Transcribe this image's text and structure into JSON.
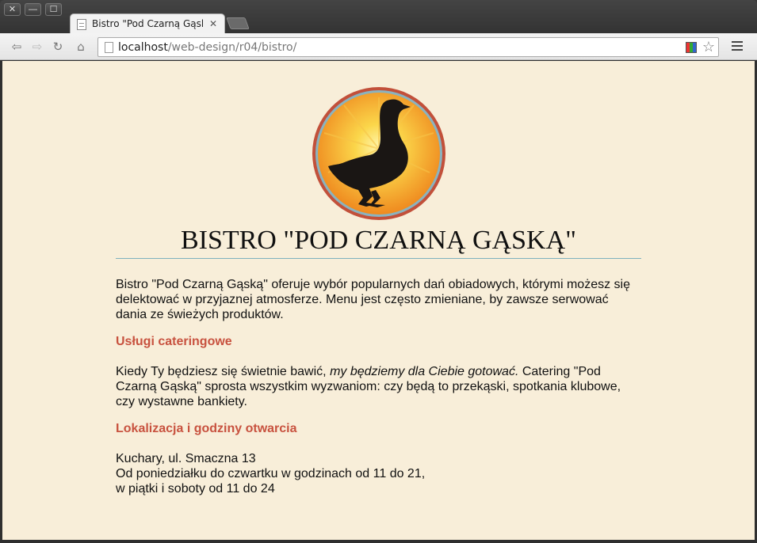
{
  "window": {
    "controls": {
      "close": "✕",
      "minimize": "—",
      "maximize": "☐"
    }
  },
  "tab": {
    "title": "Bistro \"Pod Czarną Gąską\"",
    "close_glyph": "✕"
  },
  "toolbar": {
    "url_host": "localhost",
    "url_path": "/web-design/r04/bistro/",
    "icons": [
      "back-icon",
      "forward-icon",
      "reload-icon",
      "home-icon",
      "page-icon",
      "extension-icon",
      "star-icon",
      "menu-icon"
    ]
  },
  "page": {
    "title": "BISTRO \"POD CZARNĄ GĄSKĄ\"",
    "intro": "Bistro \"Pod Czarną Gąską\" oferuje wybór popularnych dań obiadowych, którymi możesz się delektować w przyjaznej atmosferze. Menu jest często zmieniane, by zawsze serwować dania ze świeżych produktów.",
    "catering": {
      "heading": "Usługi cateringowe",
      "text_before": "Kiedy Ty będziesz się świetnie bawić, ",
      "text_em": "my będziemy dla Ciebie gotować.",
      "text_after": " Catering \"Pod Czarną Gąską\" sprosta wszystkim wyzwaniom: czy będą to przekąski, spotkania klubowe, czy wystawne bankiety."
    },
    "location": {
      "heading": "Lokalizacja i godziny otwarcia",
      "address": "Kuchary, ul. Smaczna 13",
      "hours_weekdays": "Od poniedziałku do czwartku w godzinach od 11 do 21,",
      "hours_weekend": "w piątki i soboty od 11 do 24"
    }
  },
  "colors": {
    "page_background": "#f8eed9",
    "heading_accent": "#c8523f",
    "rule": "#7fb2bd",
    "logo_orange": "#f39c2a"
  }
}
